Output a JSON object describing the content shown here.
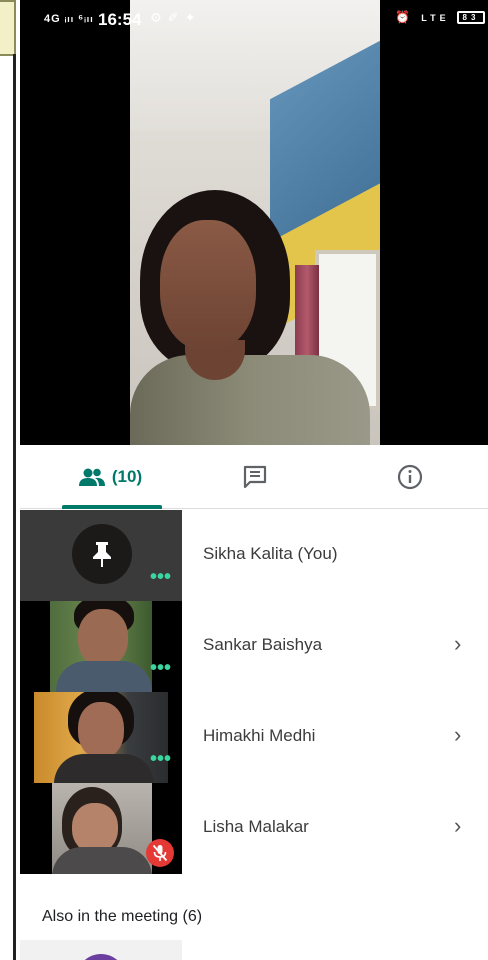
{
  "status_bar": {
    "signal": "4G ᵢₗₗ ⁶ᵢₗₗ",
    "time": "16:54",
    "right_battery": "83"
  },
  "tabs": {
    "people_count": "(10)"
  },
  "participants": [
    {
      "name": "Sikha Kalita (You)",
      "has_chevron": false
    },
    {
      "name": "Sankar Baishya",
      "has_chevron": true
    },
    {
      "name": "Himakhi Medhi",
      "has_chevron": true
    },
    {
      "name": "Lisha Malakar",
      "has_chevron": true
    }
  ],
  "also_in_meeting": "Also in the meeting (6)",
  "colors": {
    "accent": "#00796b",
    "muted_mic": "#e53935",
    "active_dots": "#3ad6a0"
  }
}
